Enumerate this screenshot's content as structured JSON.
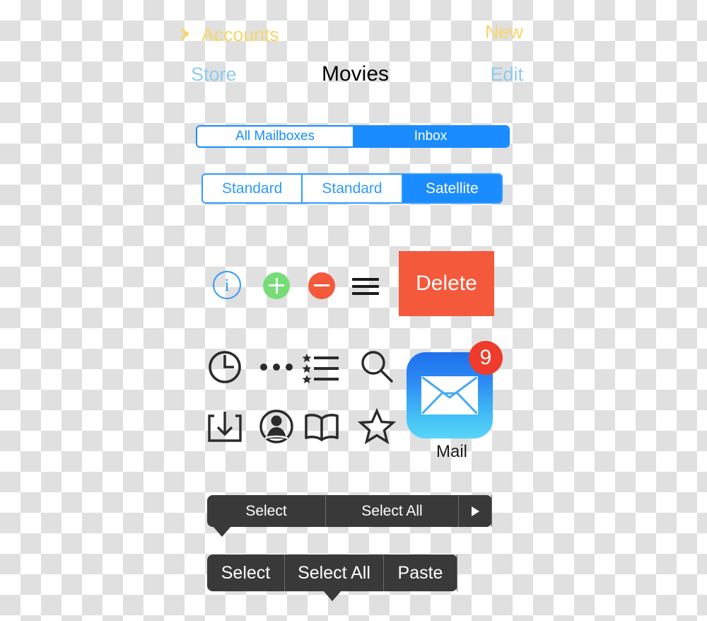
{
  "navbar": {
    "back_label": "Accounts",
    "back_icon": "chevron-left-icon",
    "right_label": "New",
    "gold_color": "#F8D66B"
  },
  "navbar2": {
    "left_label": "Store",
    "title": "Movies",
    "right_label": "Edit",
    "blue_color": "#8ECBF0"
  },
  "segmented_mail": {
    "segments": [
      {
        "label": "All Mailboxes",
        "selected": false
      },
      {
        "label": "Inbox",
        "selected": true
      }
    ],
    "accent": "#1A8CFF"
  },
  "segmented_map": {
    "segments": [
      {
        "label": "Standard",
        "selected": false
      },
      {
        "label": "Standard",
        "selected": false
      },
      {
        "label": "Satellite",
        "selected": true
      }
    ],
    "accent": "#2E9BFF"
  },
  "controls": {
    "info_glyph": "i",
    "info_icon": "info-circle-icon",
    "plus_icon": "add-circle-icon",
    "minus_icon": "remove-circle-icon",
    "reorder_icon": "reorder-handle-icon",
    "delete_label": "Delete",
    "delete_color": "#F4593C",
    "plus_color": "#76DC76",
    "minus_color": "#F4593C"
  },
  "icon_grid": {
    "row1": [
      {
        "name": "clock-icon"
      },
      {
        "name": "ellipsis-icon"
      },
      {
        "name": "bookmarks-list-icon"
      },
      {
        "name": "search-icon"
      }
    ],
    "row2": [
      {
        "name": "download-tray-icon"
      },
      {
        "name": "contacts-icon"
      },
      {
        "name": "book-icon"
      },
      {
        "name": "star-icon"
      }
    ]
  },
  "app_icon": {
    "label": "Mail",
    "badge_count": "9",
    "badge_color": "#EE3B2B",
    "gradient_top": "#1E6FEB",
    "gradient_bottom": "#58D5F8"
  },
  "context_menu_1": {
    "items": [
      "Select",
      "Select All"
    ],
    "more_icon": "arrow-right-icon",
    "background": "#393939"
  },
  "context_menu_2": {
    "items": [
      "Select",
      "Select All",
      "Paste"
    ],
    "background": "#393939"
  }
}
